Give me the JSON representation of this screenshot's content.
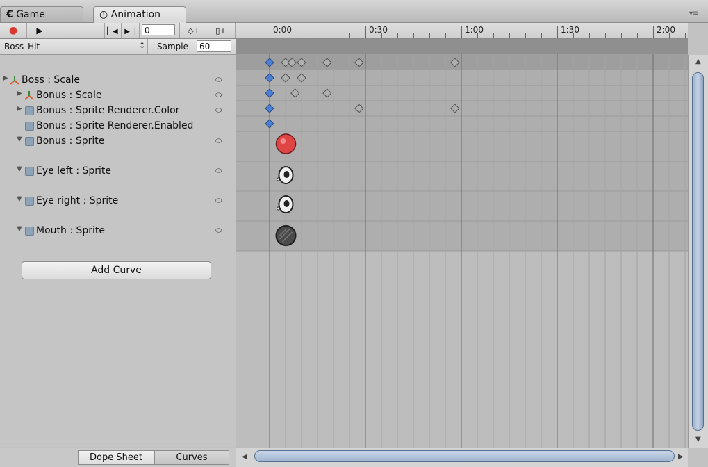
{
  "tabs": {
    "game": {
      "label": "Game",
      "icon": "game-icon"
    },
    "animation": {
      "label": "Animation",
      "icon": "clock-icon"
    },
    "menu_icon": "panel-menu-icon"
  },
  "toolbar": {
    "record_icon": "record-icon",
    "play_icon": "play-icon",
    "prev_key_icon": "previous-keyframe-icon",
    "next_key_icon": "next-keyframe-icon",
    "frame_value": "0",
    "add_key_icon": "add-keyframe-icon",
    "add_event_icon": "add-event-icon",
    "record_color": "#d83a2e"
  },
  "ruler": {
    "labels": [
      "0:00",
      "0:30",
      "1:00",
      "1:30",
      "2:00"
    ]
  },
  "clip": {
    "name": "Boss_Hit",
    "sample_label": "Sample",
    "sample_value": "60"
  },
  "properties": [
    {
      "label": "Boss : Scale",
      "icon": "transform-icon",
      "expanded": false
    },
    {
      "label": "Bonus : Scale",
      "icon": "transform-icon",
      "expanded": false
    },
    {
      "label": "Bonus : Sprite Renderer.Color",
      "icon": "sprite-renderer-icon",
      "expanded": false
    },
    {
      "label": "Bonus : Sprite Renderer.Enabled",
      "icon": "sprite-renderer-icon",
      "expanded": null
    },
    {
      "label": "Bonus : Sprite",
      "icon": "sprite-renderer-icon",
      "expanded": true
    },
    {
      "label": "Eye left : Sprite",
      "icon": "sprite-renderer-icon",
      "expanded": true
    },
    {
      "label": "Eye right : Sprite",
      "icon": "sprite-renderer-icon",
      "expanded": true
    },
    {
      "label": "Mouth : Sprite",
      "icon": "sprite-renderer-icon",
      "expanded": true
    }
  ],
  "add_curve_label": "Add Curve",
  "bottom_tabs": {
    "dope_sheet": "Dope Sheet",
    "curves": "Curves"
  },
  "keyframes": {
    "summary": [
      "0:00",
      "0:05",
      "0:07",
      "0:10",
      "0:18",
      "0:28",
      "0:58"
    ],
    "rows": [
      [
        "0:00",
        "0:05",
        "0:10"
      ],
      [
        "0:00",
        "0:08",
        "0:18"
      ],
      [
        "0:00",
        "0:28",
        "0:58"
      ],
      [
        "0:00"
      ]
    ],
    "sprite_rows": [
      {
        "sprite": "red-bonus-sprite-icon",
        "time": "0:05"
      },
      {
        "sprite": "eye-sprite-icon",
        "time": "0:05"
      },
      {
        "sprite": "eye-sprite-icon",
        "time": "0:05"
      },
      {
        "sprite": "mouth-sprite-icon",
        "time": "0:05"
      }
    ]
  },
  "colors": {
    "selected_key": "#4a7fd4",
    "key": "#b0b0b0",
    "accent": "#5c7aa8"
  }
}
